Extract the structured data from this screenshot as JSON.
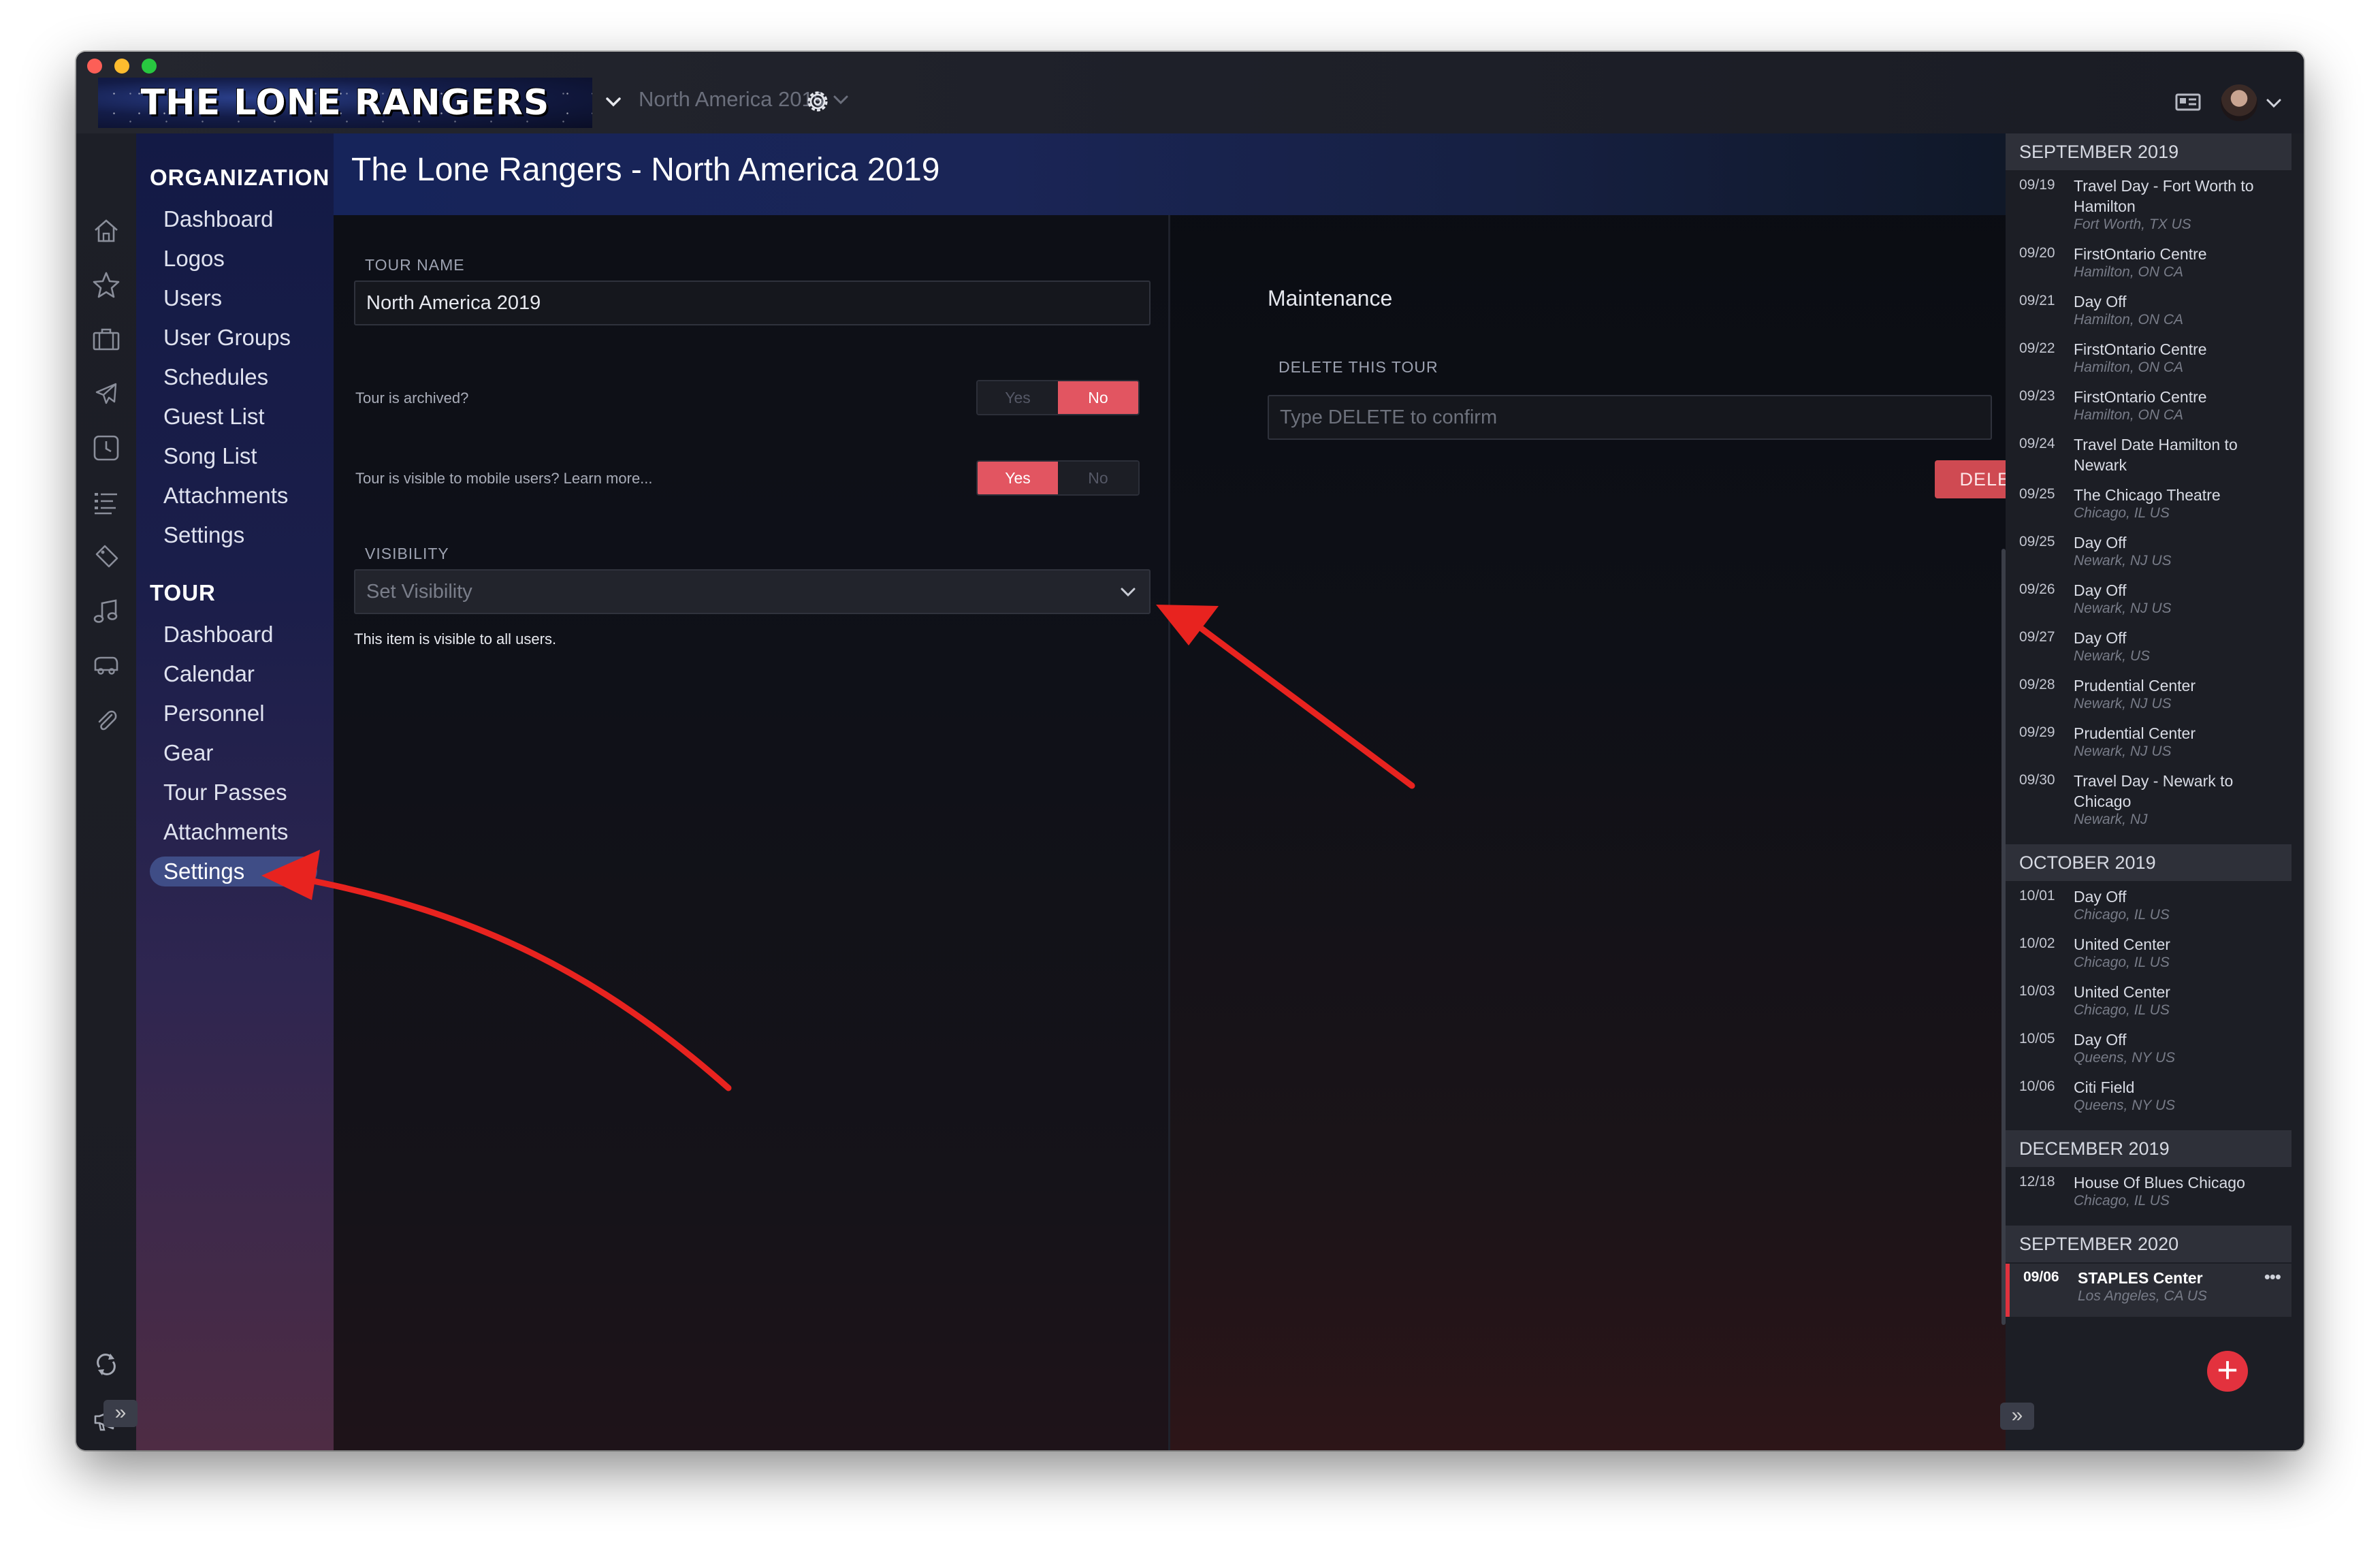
{
  "app": {
    "band_logo_text": "THE LONE RANGERS",
    "tour_selector": "North America 2019"
  },
  "nav": {
    "organization_heading": "ORGANIZATION",
    "organization_items": [
      "Dashboard",
      "Logos",
      "Users",
      "User Groups",
      "Schedules",
      "Guest List",
      "Song List",
      "Attachments",
      "Settings"
    ],
    "tour_heading": "TOUR",
    "tour_items": [
      "Dashboard",
      "Calendar",
      "Personnel",
      "Gear",
      "Tour Passes",
      "Attachments",
      "Settings"
    ],
    "active_item": "Settings",
    "collapse_glyph": "»"
  },
  "main": {
    "page_title": "The Lone Rangers - North America 2019",
    "tour_name_label": "TOUR NAME",
    "tour_name_value": "North America 2019",
    "archived_label": "Tour is archived?",
    "archived_options": [
      "Yes",
      "No"
    ],
    "archived_selected": "No",
    "mobile_label": "Tour is visible to mobile users? Learn more...",
    "mobile_options": [
      "Yes",
      "No"
    ],
    "mobile_selected": "Yes",
    "visibility_label": "VISIBILITY",
    "visibility_placeholder": "Set Visibility",
    "visibility_helper": "This item is visible to all users."
  },
  "maintenance": {
    "title": "Maintenance",
    "delete_label": "DELETE THIS TOUR",
    "delete_placeholder": "Type DELETE to confirm",
    "delete_button": "DELETE"
  },
  "schedule": {
    "groups": [
      {
        "month": "SEPTEMBER 2019",
        "items": [
          {
            "date": "09/19",
            "name": "Travel Day - Fort Worth to Hamilton",
            "location": "Fort Worth, TX US"
          },
          {
            "date": "09/20",
            "name": "FirstOntario Centre",
            "location": "Hamilton, ON CA"
          },
          {
            "date": "09/21",
            "name": "Day Off",
            "location": "Hamilton, ON CA"
          },
          {
            "date": "09/22",
            "name": "FirstOntario Centre",
            "location": "Hamilton, ON CA"
          },
          {
            "date": "09/23",
            "name": "FirstOntario Centre",
            "location": "Hamilton, ON CA"
          },
          {
            "date": "09/24",
            "name": "Travel Date Hamilton to Newark",
            "location": ""
          },
          {
            "date": "09/25",
            "name": "The Chicago Theatre",
            "location": "Chicago, IL US"
          },
          {
            "date": "09/25",
            "name": "Day Off",
            "location": "Newark, NJ US"
          },
          {
            "date": "09/26",
            "name": "Day Off",
            "location": "Newark, NJ US"
          },
          {
            "date": "09/27",
            "name": "Day Off",
            "location": "Newark, US"
          },
          {
            "date": "09/28",
            "name": "Prudential Center",
            "location": "Newark, NJ US"
          },
          {
            "date": "09/29",
            "name": "Prudential Center",
            "location": "Newark, NJ US"
          },
          {
            "date": "09/30",
            "name": "Travel Day - Newark to Chicago",
            "location": "Newark, NJ"
          }
        ]
      },
      {
        "month": "OCTOBER 2019",
        "items": [
          {
            "date": "10/01",
            "name": "Day Off",
            "location": "Chicago, IL US"
          },
          {
            "date": "10/02",
            "name": "United Center",
            "location": "Chicago, IL US"
          },
          {
            "date": "10/03",
            "name": "United Center",
            "location": "Chicago, IL US"
          },
          {
            "date": "10/05",
            "name": "Day Off",
            "location": "Queens, NY US"
          },
          {
            "date": "10/06",
            "name": "Citi Field",
            "location": "Queens, NY US"
          }
        ]
      },
      {
        "month": "DECEMBER 2019",
        "items": [
          {
            "date": "12/18",
            "name": "House Of Blues Chicago",
            "location": "Chicago, IL US"
          }
        ]
      },
      {
        "month": "SEPTEMBER 2020",
        "items": [
          {
            "date": "09/06",
            "name": "STAPLES Center",
            "location": "Los Angeles, CA US",
            "selected": true
          }
        ]
      }
    ],
    "more_glyph": "•••",
    "add_glyph": "+",
    "collapse_glyph": "»"
  },
  "colors": {
    "accent_red": "#e25561",
    "delete_red": "#cf4a52",
    "annotation_arrow": "#e8231f",
    "nav_active": "#3f4d86"
  },
  "icons": {
    "rail": [
      "home-icon",
      "star-icon",
      "briefcase-icon",
      "plane-icon",
      "clock-icon",
      "list-icon",
      "ticket-icon",
      "music-note-icon",
      "bus-icon",
      "paperclip-icon",
      "sync-icon",
      "megaphone-icon"
    ],
    "titlebar": [
      "contact-card-icon",
      "calendar-icon",
      "avatar-icon",
      "gear-icon"
    ]
  }
}
